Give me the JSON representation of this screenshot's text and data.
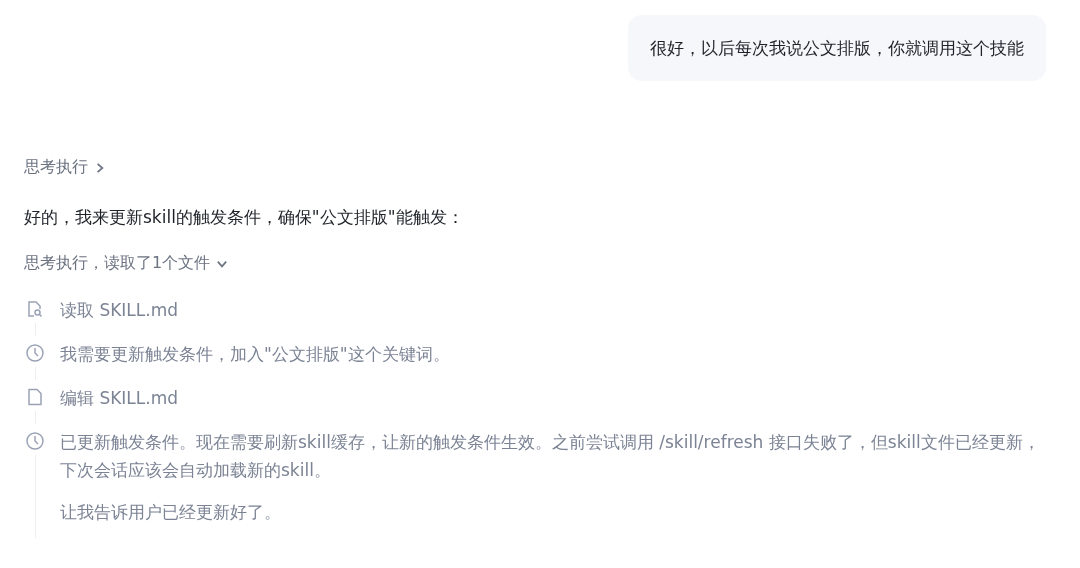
{
  "user_message": {
    "text": "很好，以后每次我说公文排版，你就调用这个技能"
  },
  "thinking_header": {
    "label": "思考执行",
    "expanded": false
  },
  "reply": {
    "text": "好的，我来更新skill的触发条件，确保\"公文排版\"能触发："
  },
  "steps_header": {
    "label": "思考执行，读取了1个文件",
    "expanded": true
  },
  "steps": [
    {
      "kind": "read",
      "paragraphs": [
        "读取 SKILL.md"
      ]
    },
    {
      "kind": "thought",
      "paragraphs": [
        "我需要更新触发条件，加入\"公文排版\"这个关键词。"
      ]
    },
    {
      "kind": "edit",
      "paragraphs": [
        "编辑 SKILL.md"
      ]
    },
    {
      "kind": "thought",
      "paragraphs": [
        "已更新触发条件。现在需要刷新skill缓存，让新的触发条件生效。之前尝试调用 /skill/refresh 接口失败了，但skill文件已经更新，下次会话应该会自动加载新的skill。",
        "让我告诉用户已经更新好了。"
      ]
    }
  ]
}
